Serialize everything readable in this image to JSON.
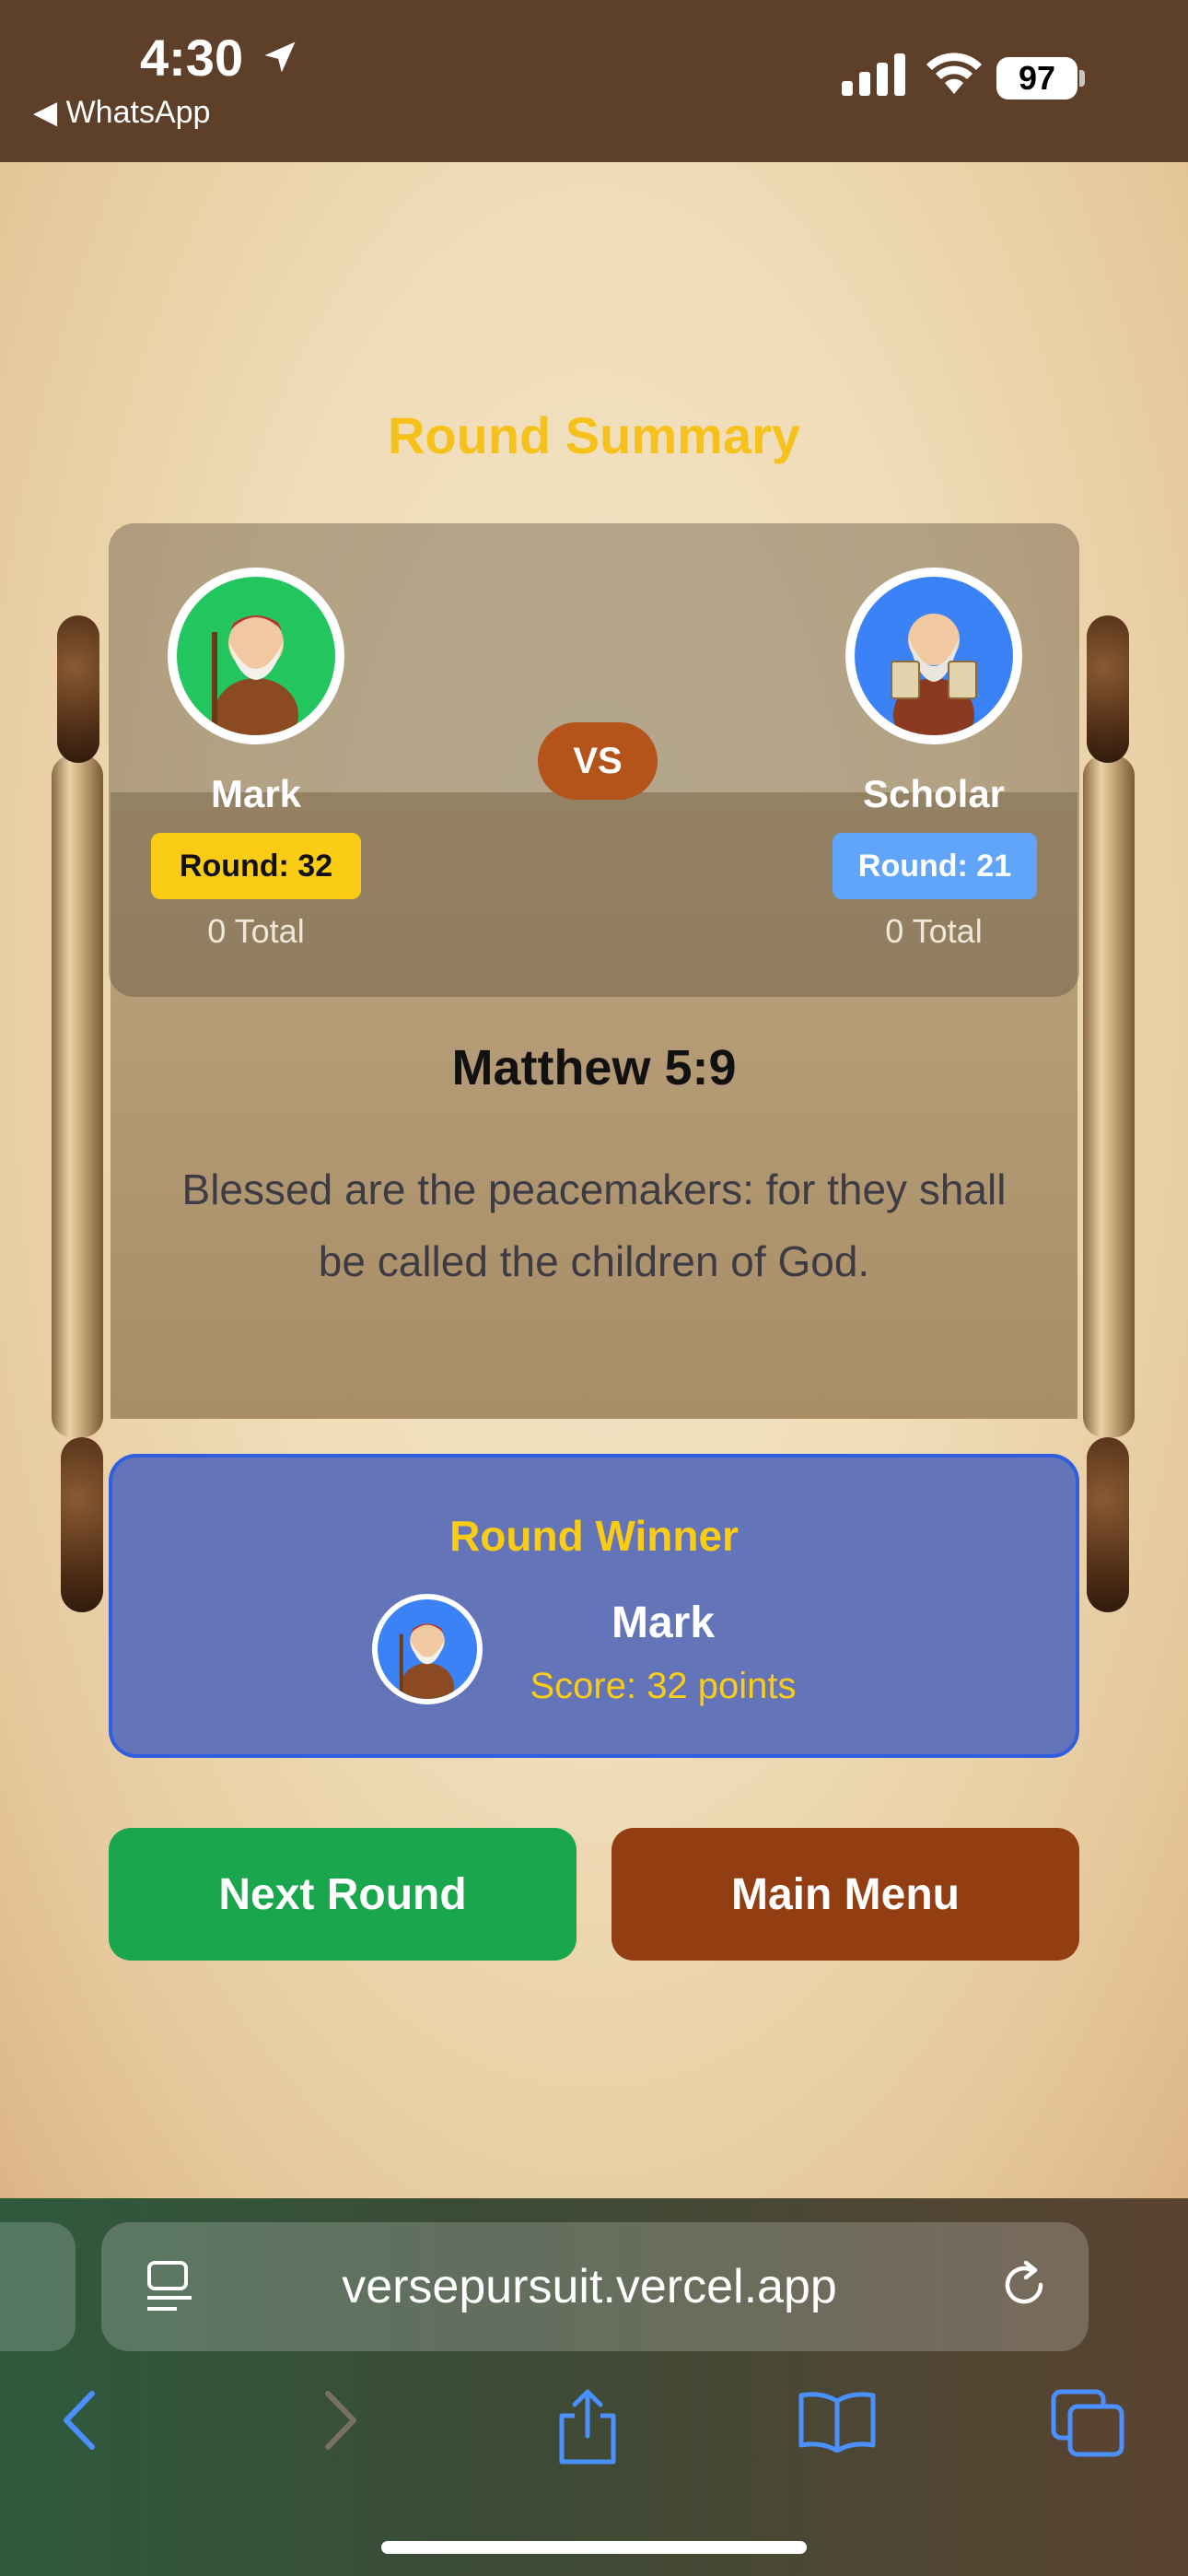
{
  "status_bar": {
    "time": "4:30",
    "back_app": "◀ WhatsApp",
    "battery": "97"
  },
  "header": {
    "title": "Round Summary"
  },
  "players": {
    "left": {
      "name": "Mark",
      "round_score": "Round: 32",
      "total": "0 Total"
    },
    "right": {
      "name": "Scholar",
      "round_score": "Round: 21",
      "total": "0 Total"
    }
  },
  "vs_label": "VS",
  "verse": {
    "reference": "Matthew 5:9",
    "text": "Blessed are the peacemakers: for they shall be called the children of God."
  },
  "winner": {
    "title": "Round Winner",
    "name": "Mark",
    "score": "Score: 32 points"
  },
  "buttons": {
    "next_round": "Next Round",
    "main_menu": "Main Menu"
  },
  "browser": {
    "url": "versepursuit.vercel.app"
  },
  "colors": {
    "accent_yellow": "#facc15",
    "winner_panel": "#6474b8",
    "next_button": "#1aa64c",
    "menu_button": "#923d12",
    "vs_badge": "#b4531a"
  }
}
